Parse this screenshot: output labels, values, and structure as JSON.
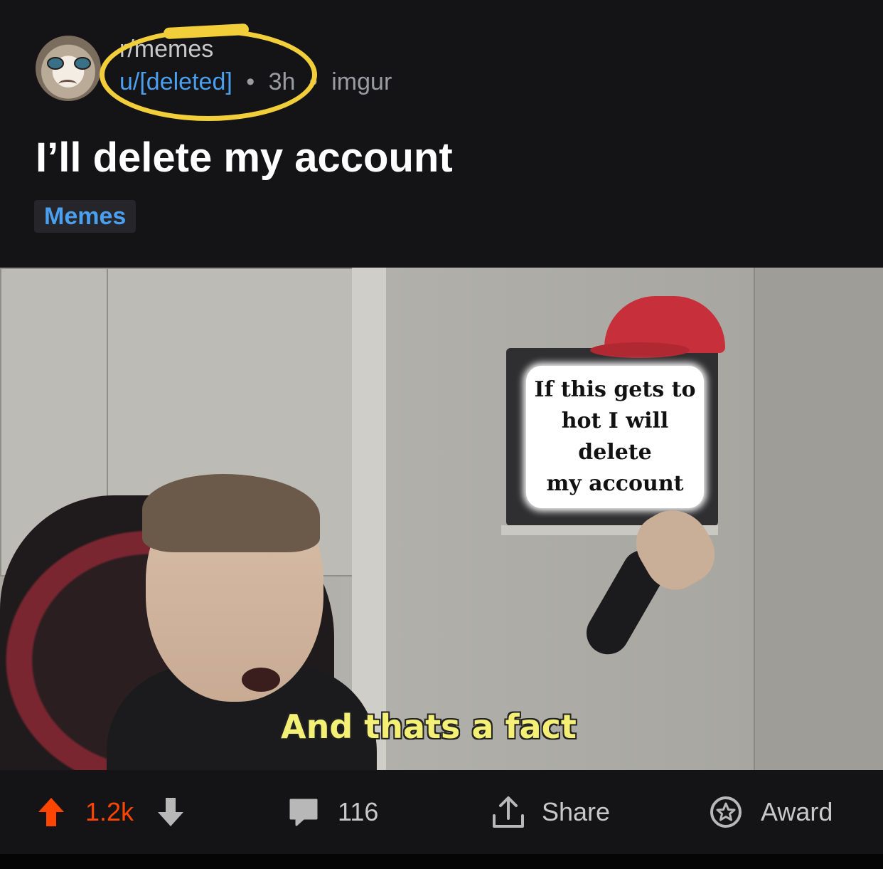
{
  "post": {
    "subreddit": "r/memes",
    "author": "u/[deleted]",
    "separator": "•",
    "age": "3h",
    "domain": "imgur",
    "title": "I’ll delete my account",
    "flair": "Memes"
  },
  "meme": {
    "tv_text": "If this gets to\nhot I will delete\nmy account",
    "caption": "And thats a fact"
  },
  "actions": {
    "score": "1.2k",
    "comments": "116",
    "share_label": "Share",
    "award_label": "Award"
  },
  "colors": {
    "upvote_accent": "#ff4500",
    "link_blue": "#4a9fee",
    "highlight_circle": "#f2cf3a",
    "background": "#141416"
  },
  "icons": [
    "subreddit-avatar",
    "upvote-icon",
    "downvote-icon",
    "comment-icon",
    "share-icon",
    "award-icon"
  ]
}
